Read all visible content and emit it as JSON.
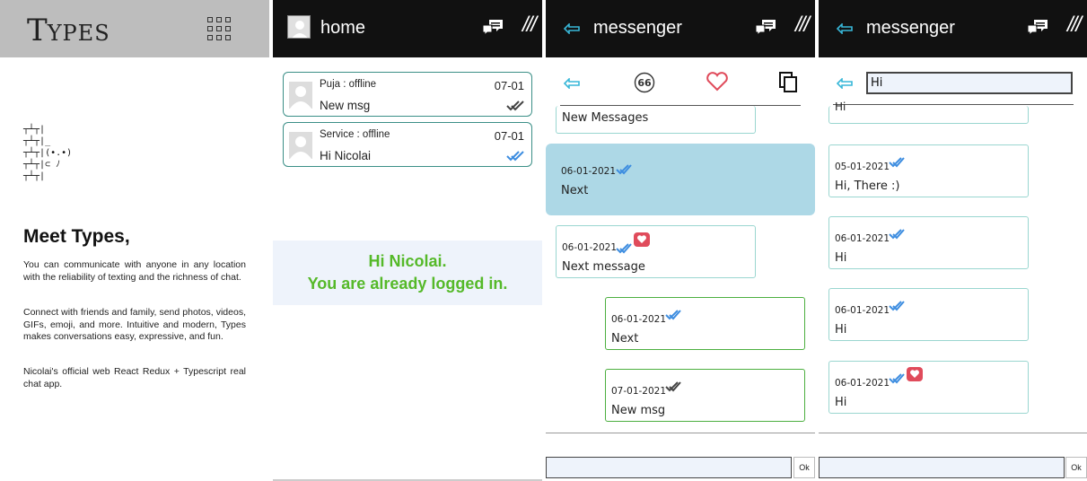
{
  "landing": {
    "logo_big": "T",
    "logo_small": "YPES",
    "menu_icon": "grid-icon",
    "art_lines": [
      "┬┴┬|",
      "┬┴┬|_",
      "┬┴┬|(•.•)",
      "┬┴┬|⊂ ﾉ",
      "┬┴┬|"
    ],
    "heading": "Meet Types,",
    "paragraph1": "You can communicate with anyone in any location with the reliability of texting and the richness of chat.",
    "paragraph2": "Connect with friends and family, send photos, videos, GIFs, emoji, and more. Intuitive and modern, Types makes conversations easy, expressive, and fun.",
    "paragraph3": "Nicolai's official web React Redux + Typescript real chat app."
  },
  "home": {
    "title": "home",
    "contacts": [
      {
        "status": "Puja : offline",
        "date": "07-01",
        "message": "New msg",
        "tick": "read"
      },
      {
        "status": "Service : offline",
        "date": "07-01",
        "message": "Hi Nicolai",
        "tick": "delivered"
      }
    ],
    "logged_line1": "Hi Nicolai.",
    "logged_line2": "You are already logged in."
  },
  "messenger": {
    "title": "messenger",
    "messages": [
      {
        "text": "New Messages"
      },
      {
        "date": "06-01-2021",
        "text": "Next"
      },
      {
        "date": "06-01-2021",
        "text": "Next message"
      },
      {
        "date": "06-01-2021",
        "text": "Next"
      },
      {
        "date": "07-01-2021",
        "text": "New msg"
      }
    ],
    "send_label": "Ok"
  },
  "messenger_search": {
    "title": "messenger",
    "search_value": "Hi",
    "partial_text": "Hi",
    "messages": [
      {
        "date": "05-01-2021",
        "text": "Hi, There :)"
      },
      {
        "date": "06-01-2021",
        "text": "Hi"
      },
      {
        "date": "06-01-2021",
        "text": "Hi"
      },
      {
        "date": "06-01-2021",
        "text": "Hi"
      }
    ],
    "send_label": "Ok"
  },
  "colors": {
    "accent_cyan": "#38b7d8",
    "logged_green": "#55b929",
    "heart_red": "#e04b5b",
    "selected_bubble": "#add8e6"
  }
}
